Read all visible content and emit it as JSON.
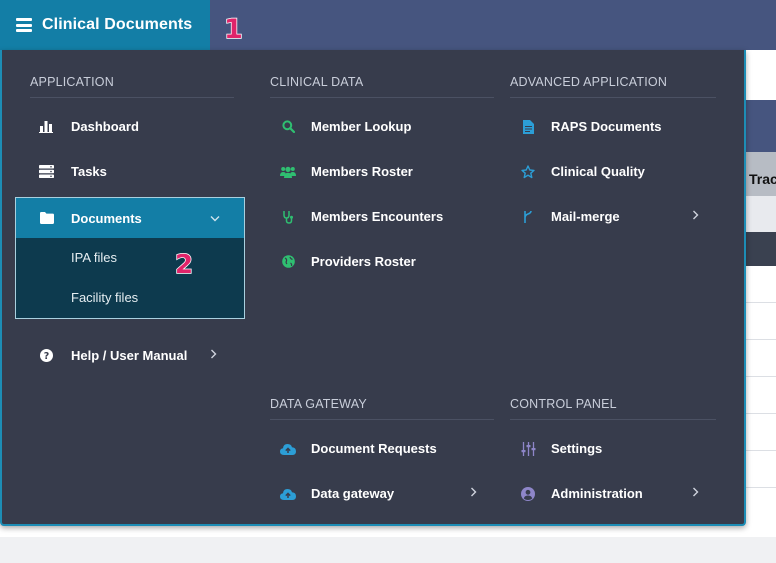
{
  "app": {
    "title": "Clinical Documents"
  },
  "callouts": {
    "one": "1",
    "two": "2"
  },
  "background": {
    "table_header_fragment": "Trac"
  },
  "menu": {
    "application": {
      "heading": "APPLICATION",
      "items": [
        {
          "label": "Dashboard",
          "icon": "bar-chart-icon"
        },
        {
          "label": "Tasks",
          "icon": "server-icon"
        }
      ],
      "documents": {
        "label": "Documents",
        "icon": "folder-icon",
        "expanded": true,
        "children": [
          {
            "label": "IPA files"
          },
          {
            "label": "Facility files"
          }
        ]
      },
      "help": {
        "label": "Help / User Manual",
        "icon": "question-circle-icon"
      }
    },
    "clinical_data": {
      "heading": "CLINICAL DATA",
      "items": [
        {
          "label": "Member Lookup",
          "icon": "search-icon"
        },
        {
          "label": "Members Roster",
          "icon": "users-icon"
        },
        {
          "label": "Members Encounters",
          "icon": "stethoscope-icon"
        },
        {
          "label": "Providers Roster",
          "icon": "globe-icon"
        }
      ]
    },
    "advanced_application": {
      "heading": "ADVANCED APPLICATION",
      "items": [
        {
          "label": "RAPS Documents",
          "icon": "file-text-icon"
        },
        {
          "label": "Clinical Quality",
          "icon": "star-icon"
        },
        {
          "label": "Mail-merge",
          "icon": "merge-icon"
        }
      ]
    },
    "data_gateway": {
      "heading": "DATA GATEWAY",
      "items": [
        {
          "label": "Document Requests",
          "icon": "cloud-upload-icon"
        },
        {
          "label": "Data gateway",
          "icon": "cloud-upload-icon"
        }
      ]
    },
    "control_panel": {
      "heading": "CONTROL PANEL",
      "items": [
        {
          "label": "Settings",
          "icon": "sliders-icon"
        },
        {
          "label": "Administration",
          "icon": "user-circle-icon"
        }
      ]
    }
  },
  "colors": {
    "topbar": "#46557f",
    "brand": "#137ea6",
    "panel": "#373c4c",
    "green_icon": "#2fbf71",
    "blue_icon": "#2c9ed6",
    "purple_icon": "#8e86c9",
    "callout": "#e0246a"
  }
}
